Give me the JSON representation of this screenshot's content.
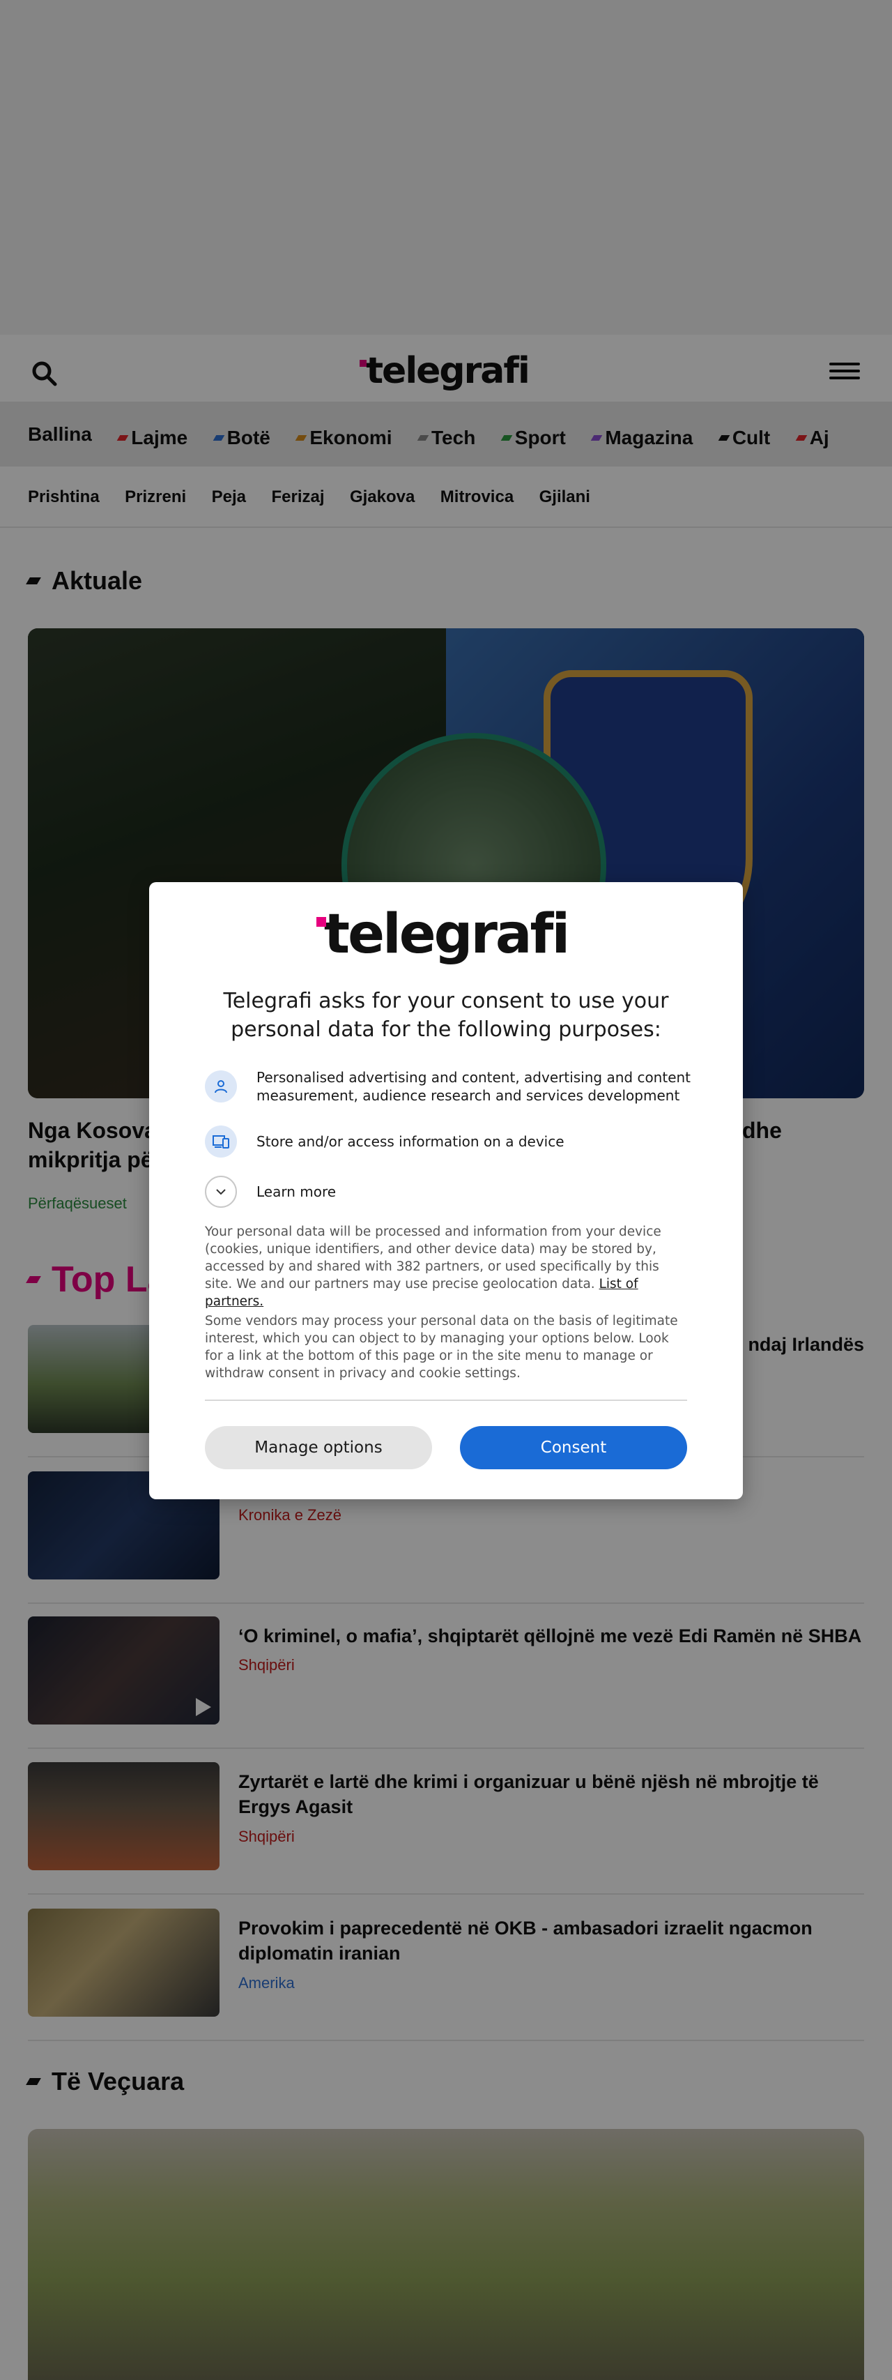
{
  "header": {
    "logo": "telegrafi"
  },
  "categories": [
    {
      "label": "Ballina",
      "color": ""
    },
    {
      "label": "Lajme",
      "color": "#e0262b"
    },
    {
      "label": "Botë",
      "color": "#2f6fd1"
    },
    {
      "label": "Ekonomi",
      "color": "#d48b1c"
    },
    {
      "label": "Tech",
      "color": "#888888"
    },
    {
      "label": "Sport",
      "color": "#2b9a3e"
    },
    {
      "label": "Magazina",
      "color": "#8a4fd1"
    },
    {
      "label": "Cult",
      "color": "#111111"
    },
    {
      "label": "Aj",
      "color": "#e0262b"
    }
  ],
  "cities": [
    "Prishtina",
    "Prizreni",
    "Peja",
    "Ferizaj",
    "Gjakova",
    "Mitrovica",
    "Gjilani"
  ],
  "aktuale": {
    "section_title": "Aktuale",
    "hero_title_left": "Nga Kosova",
    "hero_title_line2": "mikpritja pë",
    "hero_title_right": "dhe",
    "hero_category": "Përfaqësueset"
  },
  "top": {
    "section_title": "Top La",
    "items": [
      {
        "title": "ndaj Irlandës",
        "category": "",
        "cat_color": "#c01b1b"
      },
      {
        "title": "",
        "category": "Kronika e Zezë",
        "cat_color": "#c01b1b"
      },
      {
        "title": "‘O kriminel, o mafia’, shqiptarët qëllojnë me vezë Edi Ramën në SHBA",
        "category": "Shqipëri",
        "cat_color": "#c01b1b"
      },
      {
        "title": "Zyrtarët e lartë dhe krimi i organizuar u bënë njësh në mbrojtje të Ergys Agasit",
        "category": "Shqipëri",
        "cat_color": "#c01b1b"
      },
      {
        "title": "Provokim i paprecedentë në OKB - ambasadori izraelit ngacmon diplomatin iranian",
        "category": "Amerika",
        "cat_color": "#2f6fd1"
      }
    ]
  },
  "vecuara": {
    "section_title": "Të Veçuara"
  },
  "consent": {
    "logo": "telegrafi",
    "heading": "Telegrafi asks for your consent to use your personal data for the following purposes:",
    "purpose_1": "Personalised advertising and content, advertising and content measurement, audience research and services development",
    "purpose_2": "Store and/or access information on a device",
    "learn_more": "Learn more",
    "para_1": "Your personal data will be processed and information from your device (cookies, unique identifiers, and other device data) may be stored by, accessed by and shared with 382 partners, or used specifically by this site. We and our partners may use precise geolocation data.",
    "partners_link": "List of partners.",
    "para_2": "Some vendors may process your personal data on the basis of legitimate interest, which you can object to by managing your options below. Look for a link at the bottom of this page or in the site menu to manage or withdraw consent in privacy and cookie settings.",
    "manage_button": "Manage options",
    "consent_button": "Consent"
  },
  "colors": {
    "accent": "#e6007e",
    "aktuale_title": "#111111",
    "top_title": "#e6007e",
    "consent_button": "#1a6bd6",
    "hero_category": "#2b8a3e"
  }
}
